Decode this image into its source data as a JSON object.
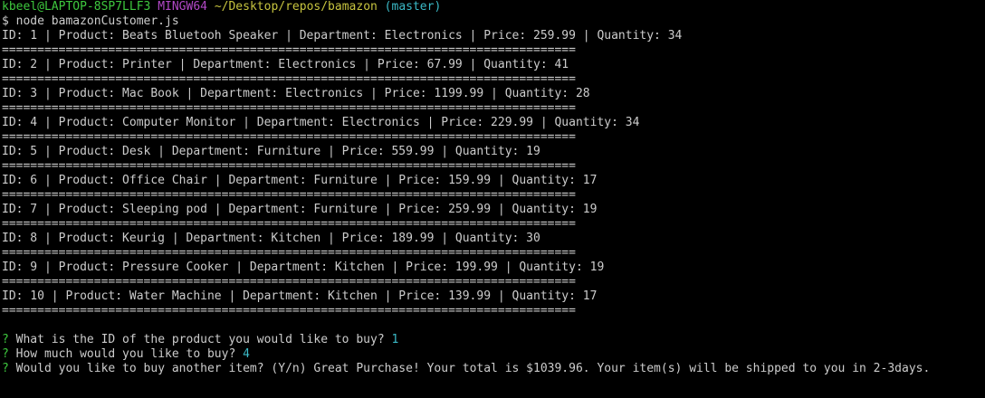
{
  "prompt": {
    "user_host": "kbeel@LAPTOP-8SP7LLF3",
    "env": "MINGW64",
    "path": "~/Desktop/repos/bamazon",
    "branch": "(master)",
    "command": "$ node bamazonCustomer.js"
  },
  "separator": "=================================================================================",
  "products": [
    "ID: 1 | Product: Beats Bluetooh Speaker | Department: Electronics | Price: 259.99 | Quantity: 34",
    "ID: 2 | Product: Printer | Department: Electronics | Price: 67.99 | Quantity: 41",
    "ID: 3 | Product: Mac Book | Department: Electronics | Price: 1199.99 | Quantity: 28",
    "ID: 4 | Product: Computer Monitor | Department: Electronics | Price: 229.99 | Quantity: 34",
    "ID: 5 | Product: Desk | Department: Furniture | Price: 559.99 | Quantity: 19",
    "ID: 6 | Product: Office Chair | Department: Furniture | Price: 159.99 | Quantity: 17",
    "ID: 7 | Product: Sleeping pod | Department: Furniture | Price: 259.99 | Quantity: 19",
    "ID: 8 | Product: Keurig | Department: Kitchen | Price: 189.99 | Quantity: 30",
    "ID: 9 | Product: Pressure Cooker | Department: Kitchen | Price: 199.99 | Quantity: 19",
    "ID: 10 | Product: Water Machine | Department: Kitchen | Price: 139.99 | Quantity: 17"
  ],
  "questions": [
    {
      "mark": "?",
      "text": "What is the ID of the product you would like to buy?",
      "answer": "1"
    },
    {
      "mark": "?",
      "text": "How much would you like to buy?",
      "answer": "4"
    },
    {
      "mark": "?",
      "text": "Would you like to buy another item? (Y/n) Great Purchase! Your total is $1039.96. Your item(s) will be shipped to you in 2-3days.",
      "answer": ""
    }
  ],
  "colors": {
    "background": "#000000",
    "text": "#cccccc",
    "green": "#3ec83e",
    "magenta": "#b148c6",
    "yellow": "#c7c43f",
    "cyan": "#3bbac7"
  }
}
